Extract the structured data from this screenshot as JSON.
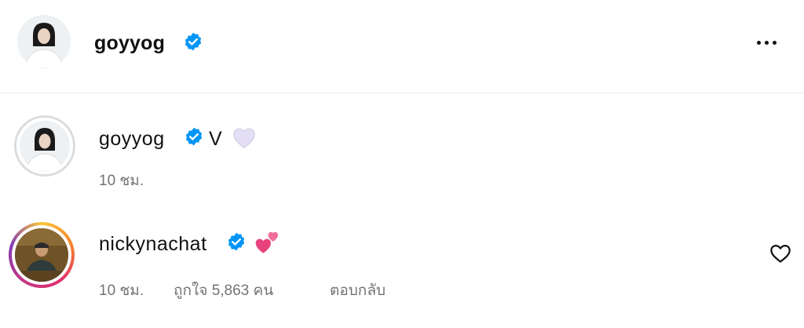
{
  "header": {
    "username": "goyyog",
    "verified": true,
    "more_icon": "more-horizontal-icon"
  },
  "comments": [
    {
      "username": "goyyog",
      "verified": true,
      "text": "V",
      "emoji": "white-heart",
      "time": "10 ชม."
    },
    {
      "username": "nickynachat",
      "verified": true,
      "emoji": "two-hearts",
      "time": "10 ชม.",
      "likes_label": "ถูกใจ 5,863 คน",
      "reply_label": "ตอบกลับ",
      "like_icon": "heart-outline-icon"
    }
  ],
  "colors": {
    "verified_blue": "#0095f6",
    "meta_gray": "#737373",
    "pink": "#e8427c",
    "white_heart": "#d9d3ee"
  }
}
